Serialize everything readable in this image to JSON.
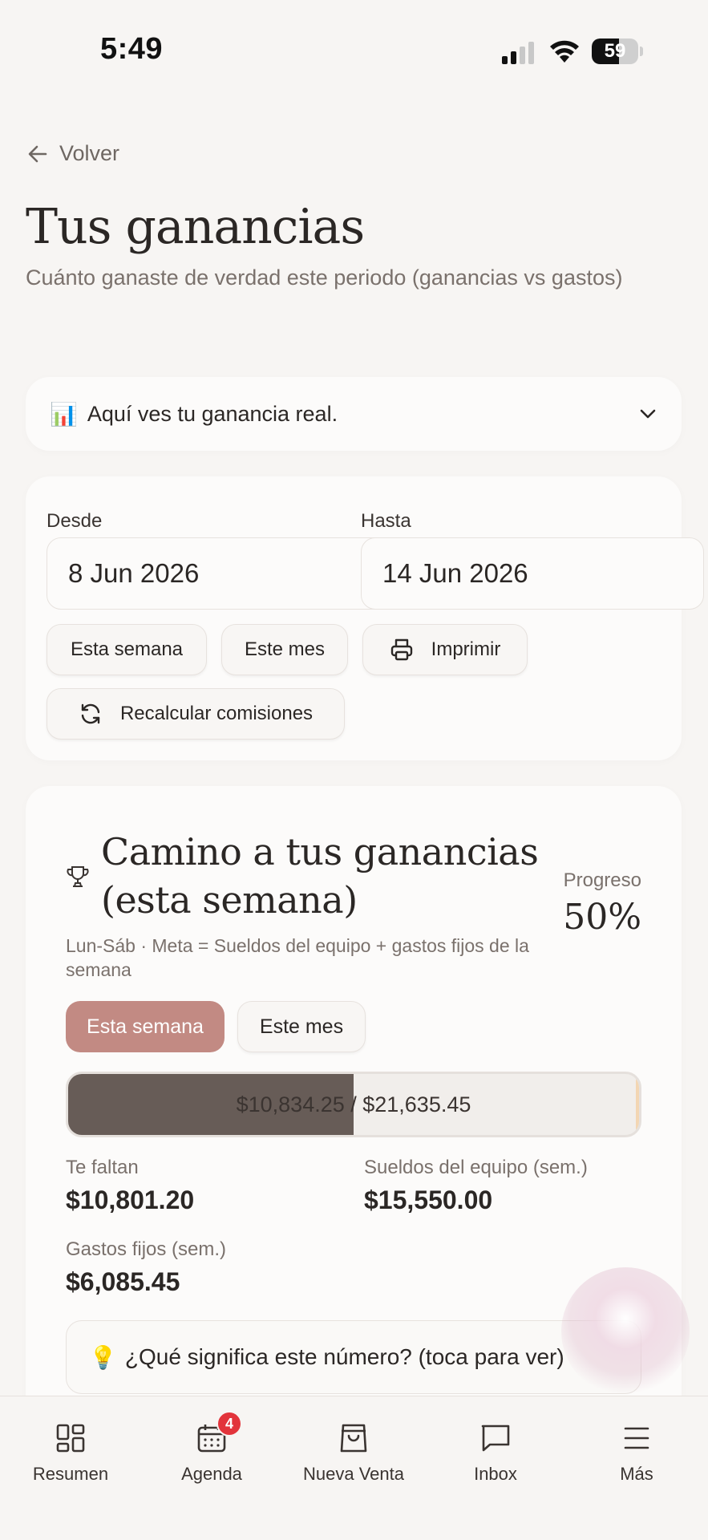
{
  "status_bar": {
    "time": "5:49",
    "battery": "59",
    "battery_level": 0.59
  },
  "header": {
    "back_label": "Volver",
    "title": "Tus ganancias",
    "subtitle": "Cuánto ganaste de verdad este periodo (ganancias vs gastos)"
  },
  "info_panel": {
    "emoji": "📊",
    "text": "Aquí ves tu ganancia real."
  },
  "date_range": {
    "from_label": "Desde",
    "from_value": "8 Jun 2026",
    "to_label": "Hasta",
    "to_value": "14 Jun 2026",
    "buttons": {
      "this_week": "Esta semana",
      "this_month": "Este mes",
      "print": "Imprimir",
      "recalc": "Recalcular comisiones"
    }
  },
  "progress": {
    "title": "Camino a tus ganancias (esta semana)",
    "progress_label": "Progreso",
    "progress_pct": "50%",
    "progress_fraction": 0.5,
    "subtitle": "Lun-Sáb · Meta = Sueldos del equipo + gastos fijos de la semana",
    "tabs": {
      "week": "Esta semana",
      "month": "Este mes"
    },
    "bar_text": "$10,834.25 / $21,635.45",
    "stats": {
      "remaining_label": "Te faltan",
      "remaining_value": "$10,801.20",
      "salaries_label": "Sueldos del equipo (sem.)",
      "salaries_value": "$15,550.00",
      "fixed_label": "Gastos fijos (sem.)",
      "fixed_value": "$6,085.45"
    },
    "hint_emoji": "💡",
    "hint_text": "¿Qué significa este número? (toca para ver)"
  },
  "bottom_nav": {
    "items": [
      {
        "label": "Resumen",
        "icon": "grid-icon"
      },
      {
        "label": "Agenda",
        "icon": "calendar-icon",
        "badge": "4"
      },
      {
        "label": "Nueva Venta",
        "icon": "bag-icon"
      },
      {
        "label": "Inbox",
        "icon": "message-icon"
      },
      {
        "label": "Más",
        "icon": "menu-icon"
      }
    ]
  },
  "colors": {
    "accent": "#c28a83",
    "bar_fill": "#675c57",
    "badge": "#e2343b",
    "background": "#f7f5f3"
  }
}
